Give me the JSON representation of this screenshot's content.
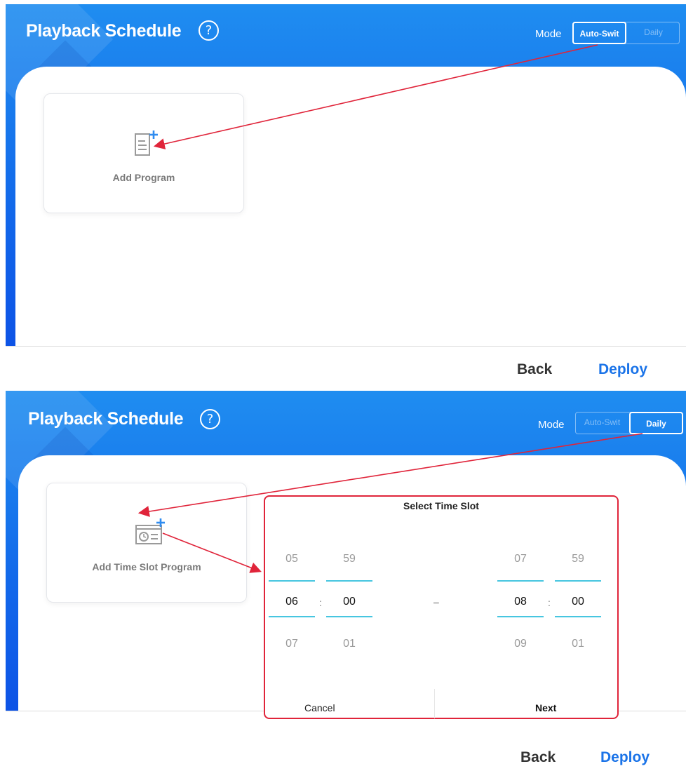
{
  "panels": [
    {
      "title": "Playback Schedule",
      "help_glyph": "?",
      "mode_label": "Mode",
      "mode_options": [
        "Auto-Swit",
        "Daily"
      ],
      "active_mode": "Auto-Swit",
      "tile_label": "Add Program",
      "tile_icon": "add-program-icon",
      "back_label": "Back",
      "deploy_label": "Deploy"
    },
    {
      "title": "Playback Schedule",
      "help_glyph": "?",
      "mode_label": "Mode",
      "mode_options": [
        "Auto-Swit",
        "Daily"
      ],
      "active_mode": "Daily",
      "tile_label": "Add Time Slot Program",
      "tile_icon": "add-time-slot-icon",
      "back_label": "Back",
      "deploy_label": "Deploy"
    }
  ],
  "time_slot_dialog": {
    "title": "Select Time Slot",
    "start": {
      "hour": {
        "prev": "05",
        "current": "06",
        "next": "07"
      },
      "minute": {
        "prev": "59",
        "current": "00",
        "next": "01"
      }
    },
    "end": {
      "hour": {
        "prev": "07",
        "current": "08",
        "next": "09"
      },
      "minute": {
        "prev": "59",
        "current": "00",
        "next": "01"
      }
    },
    "separator": ":",
    "range_dash": "–",
    "cancel_label": "Cancel",
    "next_label": "Next"
  },
  "colors": {
    "header_blue": "#1268ea",
    "accent_blue": "#1a73e8",
    "annotation_red": "#e0243a",
    "picker_line": "#47c6e0"
  }
}
